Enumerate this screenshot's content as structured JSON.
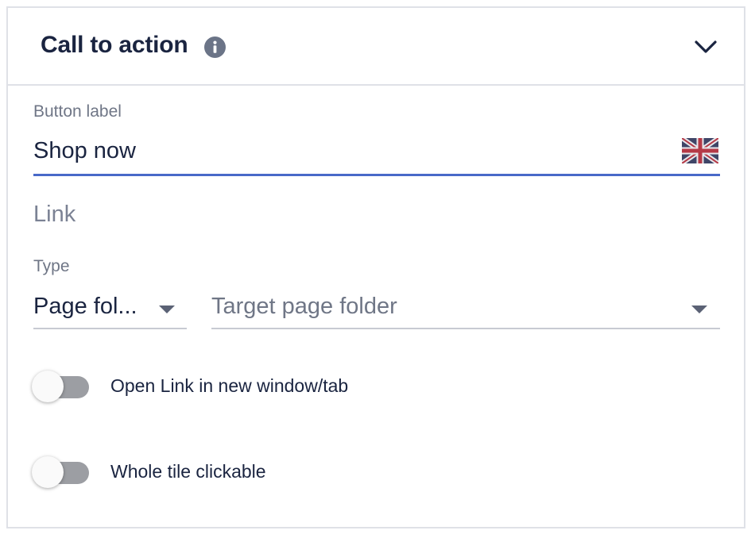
{
  "panel": {
    "title": "Call to action",
    "info_icon": "info-icon",
    "collapse_icon": "chevron-down-icon"
  },
  "button_label": {
    "label": "Button label",
    "value": "Shop now",
    "language_icon": "uk-flag-icon"
  },
  "link": {
    "heading": "Link",
    "type_label": "Type",
    "type_value": "Page fol...",
    "target_placeholder": "Target page folder"
  },
  "toggles": {
    "new_window": {
      "label": "Open Link in new window/tab",
      "checked": false
    },
    "whole_tile": {
      "label": "Whole tile clickable",
      "checked": false
    }
  },
  "colors": {
    "accent": "#4869c8",
    "text": "#1a2440",
    "muted": "#6f7686",
    "border": "#dfe1e7"
  }
}
